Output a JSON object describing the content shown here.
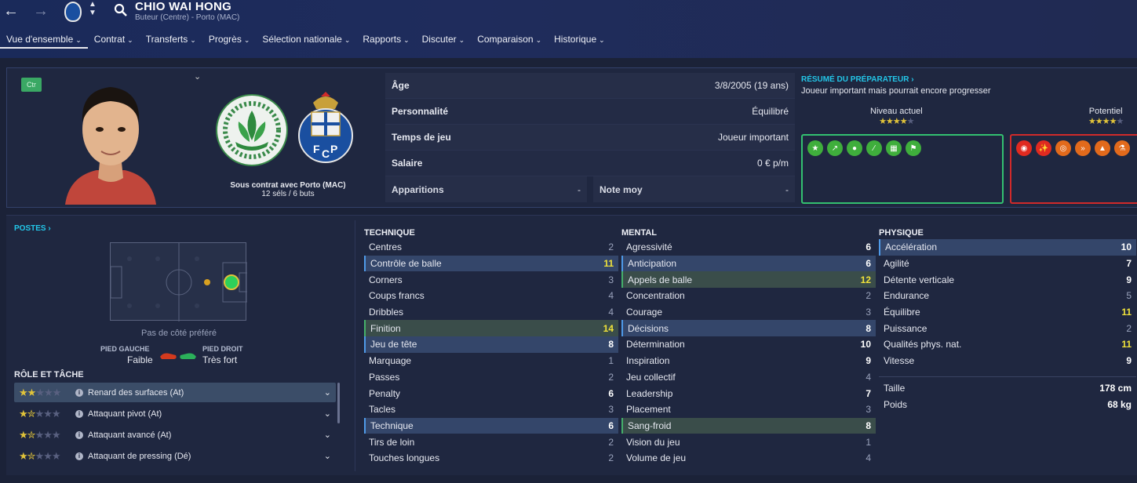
{
  "header": {
    "player_name": "CHIO WAI HONG",
    "subtitle": "Buteur (Centre) - Porto (MAC)",
    "menu": [
      {
        "label": "Vue d'ensemble",
        "active": true
      },
      {
        "label": "Contrat"
      },
      {
        "label": "Transferts"
      },
      {
        "label": "Progrès"
      },
      {
        "label": "Sélection nationale"
      },
      {
        "label": "Rapports"
      },
      {
        "label": "Discuter"
      },
      {
        "label": "Comparaison"
      },
      {
        "label": "Historique"
      }
    ]
  },
  "profile": {
    "position_badge": "Ctr",
    "contract_line": "Sous contrat avec Porto (MAC)",
    "caps_line": "12 séls / 6 buts"
  },
  "info": {
    "age_label": "Âge",
    "age_value": "3/8/2005 (19 ans)",
    "personality_label": "Personnalité",
    "personality_value": "Équilibré",
    "playing_time_label": "Temps de jeu",
    "playing_time_value": "Joueur important",
    "salary_label": "Salaire",
    "salary_value": "0 € p/m",
    "apps_label": "Apparitions",
    "apps_value": "-",
    "rating_label": "Note moy",
    "rating_value": "-"
  },
  "coach": {
    "title": "RÉSUMÉ DU PRÉPARATEUR",
    "summary": "Joueur important mais pourrait encore progresser",
    "current_label": "Niveau actuel",
    "current_stars": 3.5,
    "potential_label": "Potentiel",
    "potential_stars": 3.5
  },
  "positions": {
    "title": "POSTES",
    "side_text": "Pas de côté préféré",
    "left_foot_label": "PIED GAUCHE",
    "left_foot_value": "Faible",
    "right_foot_label": "PIED DROIT",
    "right_foot_value": "Très fort"
  },
  "roles": {
    "title": "RÔLE ET TÂCHE",
    "items": [
      {
        "label": "Renard des surfaces (At)",
        "stars": 2
      },
      {
        "label": "Attaquant pivot (At)",
        "stars": 1.5
      },
      {
        "label": "Attaquant avancé (At)",
        "stars": 1.5
      },
      {
        "label": "Attaquant de pressing (Dé)",
        "stars": 1.5
      }
    ]
  },
  "attributes": {
    "technique_title": "TECHNIQUE",
    "technique": [
      {
        "name": "Centres",
        "value": "2",
        "style": "dim",
        "hl": ""
      },
      {
        "name": "Contrôle de balle",
        "value": "11",
        "style": "y",
        "hl": "blue"
      },
      {
        "name": "Corners",
        "value": "3",
        "style": "dim",
        "hl": ""
      },
      {
        "name": "Coups francs",
        "value": "4",
        "style": "dim",
        "hl": ""
      },
      {
        "name": "Dribbles",
        "value": "4",
        "style": "dim",
        "hl": ""
      },
      {
        "name": "Finition",
        "value": "14",
        "style": "y",
        "hl": "green"
      },
      {
        "name": "Jeu de tête",
        "value": "8",
        "style": "",
        "hl": "blue"
      },
      {
        "name": "Marquage",
        "value": "1",
        "style": "dim",
        "hl": ""
      },
      {
        "name": "Passes",
        "value": "2",
        "style": "dim",
        "hl": ""
      },
      {
        "name": "Penalty",
        "value": "6",
        "style": "",
        "hl": ""
      },
      {
        "name": "Tacles",
        "value": "3",
        "style": "dim",
        "hl": ""
      },
      {
        "name": "Technique",
        "value": "6",
        "style": "",
        "hl": "blue"
      },
      {
        "name": "Tirs de loin",
        "value": "2",
        "style": "dim",
        "hl": ""
      },
      {
        "name": "Touches longues",
        "value": "2",
        "style": "dim",
        "hl": ""
      }
    ],
    "mental_title": "MENTAL",
    "mental": [
      {
        "name": "Agressivité",
        "value": "6",
        "style": "",
        "hl": ""
      },
      {
        "name": "Anticipation",
        "value": "6",
        "style": "",
        "hl": "blue"
      },
      {
        "name": "Appels de balle",
        "value": "12",
        "style": "y",
        "hl": "green"
      },
      {
        "name": "Concentration",
        "value": "2",
        "style": "dim",
        "hl": ""
      },
      {
        "name": "Courage",
        "value": "3",
        "style": "dim",
        "hl": ""
      },
      {
        "name": "Décisions",
        "value": "8",
        "style": "",
        "hl": "blue"
      },
      {
        "name": "Détermination",
        "value": "10",
        "style": "",
        "hl": ""
      },
      {
        "name": "Inspiration",
        "value": "9",
        "style": "",
        "hl": ""
      },
      {
        "name": "Jeu collectif",
        "value": "4",
        "style": "dim",
        "hl": ""
      },
      {
        "name": "Leadership",
        "value": "7",
        "style": "",
        "hl": ""
      },
      {
        "name": "Placement",
        "value": "3",
        "style": "dim",
        "hl": ""
      },
      {
        "name": "Sang-froid",
        "value": "8",
        "style": "",
        "hl": "green"
      },
      {
        "name": "Vision du jeu",
        "value": "1",
        "style": "dim",
        "hl": ""
      },
      {
        "name": "Volume de jeu",
        "value": "4",
        "style": "dim",
        "hl": ""
      }
    ],
    "physical_title": "PHYSIQUE",
    "physical": [
      {
        "name": "Accélération",
        "value": "10",
        "style": "",
        "hl": "blue"
      },
      {
        "name": "Agilité",
        "value": "7",
        "style": "",
        "hl": ""
      },
      {
        "name": "Détente verticale",
        "value": "9",
        "style": "",
        "hl": ""
      },
      {
        "name": "Endurance",
        "value": "5",
        "style": "dim",
        "hl": ""
      },
      {
        "name": "Équilibre",
        "value": "11",
        "style": "y",
        "hl": ""
      },
      {
        "name": "Puissance",
        "value": "2",
        "style": "dim",
        "hl": ""
      },
      {
        "name": "Qualités phys. nat.",
        "value": "11",
        "style": "y",
        "hl": ""
      },
      {
        "name": "Vitesse",
        "value": "9",
        "style": "",
        "hl": ""
      }
    ],
    "height_label": "Taille",
    "height_value": "178 cm",
    "weight_label": "Poids",
    "weight_value": "68 kg"
  },
  "colors": {
    "accent": "#23c6e8",
    "highlight_blue": "#34466a",
    "highlight_green": "#3a4d4a",
    "strength_border": "#33c070",
    "weakness_border": "#d02a2a"
  },
  "icons": {
    "strengths": [
      "star-icon",
      "trend-up-icon",
      "head-icon",
      "boot-icon",
      "net-icon",
      "flag-icon"
    ],
    "weaknesses": [
      "eye-icon",
      "tackle-icon",
      "target-icon",
      "pass-icon",
      "cone-icon",
      "flask-icon"
    ]
  }
}
